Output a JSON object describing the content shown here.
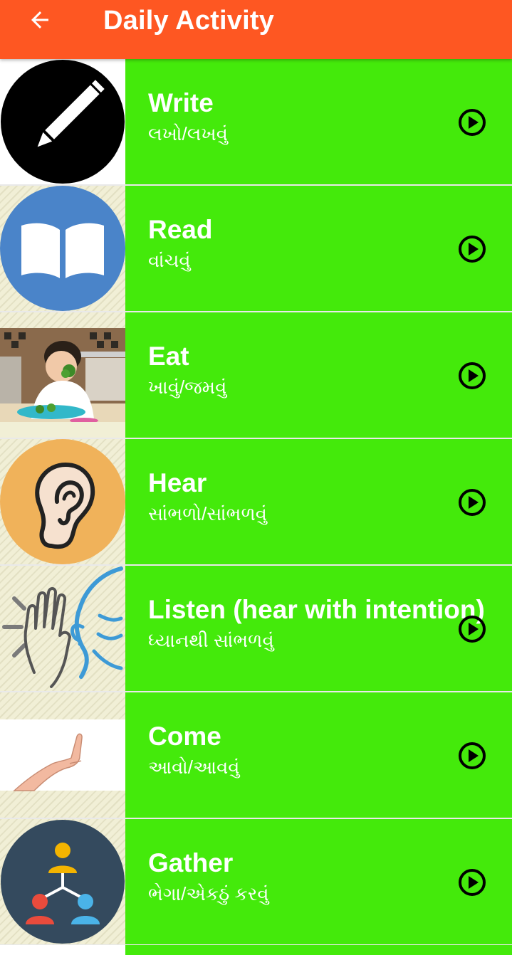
{
  "appbar": {
    "title": "Daily Activity",
    "back_icon": "arrow-left-icon",
    "background": "#fe5722"
  },
  "list": {
    "tile_color": "#44ea0b",
    "play_icon": "play-circle-icon",
    "items": [
      {
        "title": "Write",
        "subtitle": "લખો/લખવું",
        "image": "pencil-icon"
      },
      {
        "title": "Read",
        "subtitle": "વાંચવું",
        "image": "open-book-icon"
      },
      {
        "title": "Eat",
        "subtitle": "ખાવું/જમવું",
        "image": "child-eating-photo"
      },
      {
        "title": "Hear",
        "subtitle": "સાંભળો/સાંભળવું",
        "image": "ear-icon"
      },
      {
        "title": "Listen (hear with intention)",
        "subtitle": "ધ્યાનથી સાંભળવું",
        "image": "hand-cupped-ear-icon"
      },
      {
        "title": "Come",
        "subtitle": "આવો/આવવું",
        "image": "beckoning-hand-icon"
      },
      {
        "title": "Gather",
        "subtitle": "ભેગા/એકઠું કરવું",
        "image": "people-network-icon"
      }
    ]
  }
}
